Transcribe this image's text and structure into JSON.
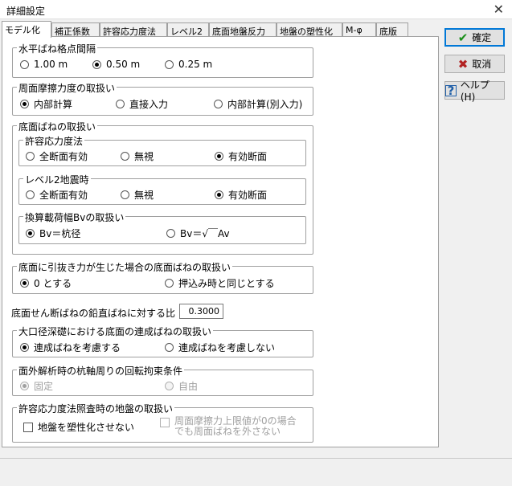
{
  "window": {
    "title": "詳細設定",
    "close_glyph": "✕"
  },
  "tabs": [
    {
      "label": "モデル化"
    },
    {
      "label": "補正係数"
    },
    {
      "label": "許容応力度法"
    },
    {
      "label": "レベル2"
    },
    {
      "label": "底面地盤反力"
    },
    {
      "label": "地盤の塑性化"
    },
    {
      "label": "M-φ"
    },
    {
      "label": "底版"
    }
  ],
  "groups": {
    "spring_grid": {
      "title": "水平ばね格点間隔",
      "options": [
        "1.00 m",
        "0.50 m",
        "0.25 m"
      ],
      "selected": 1
    },
    "friction": {
      "title": "周面摩擦力度の取扱い",
      "options": [
        "内部計算",
        "直接入力",
        "内部計算(別入力)"
      ],
      "selected": 0
    },
    "base_spring": {
      "title": "底面ばねの取扱い",
      "allowable": {
        "title": "許容応力度法",
        "options": [
          "全断面有効",
          "無視",
          "有効断面"
        ],
        "selected": 2
      },
      "level2": {
        "title": "レベル2地震時",
        "options": [
          "全断面有効",
          "無視",
          "有効断面"
        ],
        "selected": 2
      },
      "bv": {
        "title": "換算載荷幅Bvの取扱い",
        "options": [
          "Bv＝杭径",
          "Bv＝√￣Av"
        ],
        "selected": 0
      }
    },
    "pullout": {
      "title": "底面に引抜き力が生じた場合の底面ばねの取扱い",
      "options": [
        "0 とする",
        "押込み時と同じとする"
      ],
      "selected": 0
    },
    "shear_ratio": {
      "label": "底面せん断ばねの鉛直ばねに対する比",
      "value": "0.3000"
    },
    "coupled": {
      "title": "大口径深礎における底面の連成ばねの取扱い",
      "options": [
        "連成ばねを考慮する",
        "連成ばねを考慮しない"
      ],
      "selected": 0
    },
    "rotation": {
      "title": "面外解析時の杭軸周りの回転拘束条件",
      "options": [
        "固定",
        "自由"
      ],
      "selected": 0
    },
    "ground": {
      "title": "許容応力度法照査時の地盤の取扱い",
      "check1": "地盤を塑性化させない",
      "check2_line1": "周面摩擦力上限値が0の場合",
      "check2_line2": "でも周面ばねを外さない"
    }
  },
  "buttons": {
    "ok": "確定",
    "cancel": "取消",
    "help": "ヘルプ(H)"
  }
}
